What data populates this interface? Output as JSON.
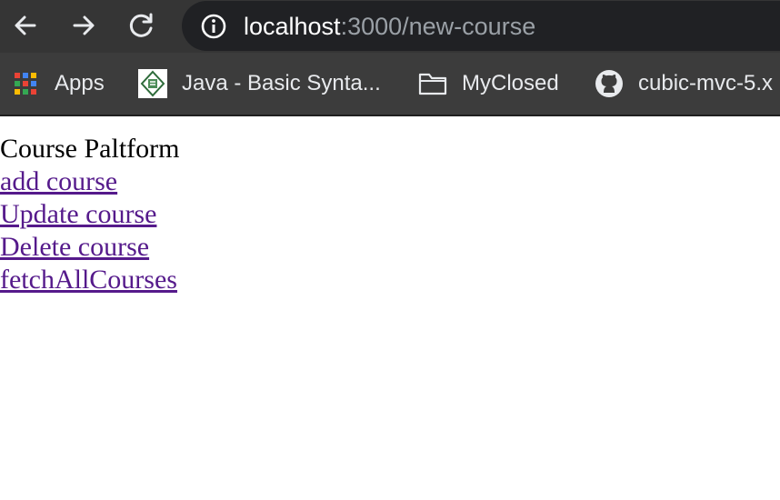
{
  "browser": {
    "url_host": "localhost",
    "url_path": ":3000/new-course",
    "bookmarks": [
      {
        "label": "Apps",
        "icon": "apps-grid-icon"
      },
      {
        "label": "Java - Basic Synta...",
        "icon": "java-favicon-icon"
      },
      {
        "label": "MyClosed",
        "icon": "folder-icon"
      },
      {
        "label": "cubic-mvc-5.x",
        "icon": "github-icon"
      }
    ]
  },
  "page": {
    "title": "Course Paltform",
    "links": [
      {
        "label": "add course"
      },
      {
        "label": "Update course"
      },
      {
        "label": "Delete course"
      },
      {
        "label": "fetchAllCourses"
      }
    ]
  },
  "colors": {
    "link_visited": "#551a8b",
    "chrome_bg": "#3c3c3c",
    "omnibox_bg": "#202124"
  }
}
